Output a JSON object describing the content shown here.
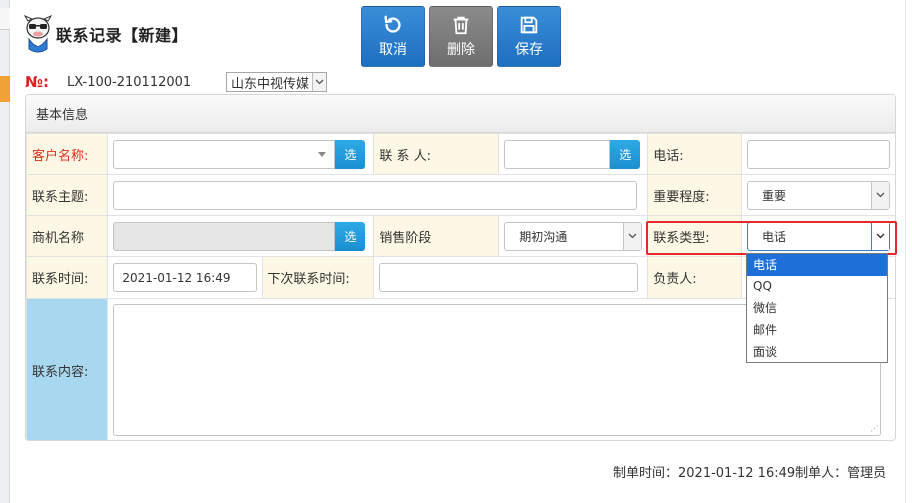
{
  "page": {
    "title": "联系记录【新建】",
    "number_label": "№:",
    "number_value": "LX-100-210112001",
    "company": "山东中视传媒"
  },
  "toolbar": {
    "cancel_label": "取消",
    "delete_label": "删除",
    "save_label": "保存"
  },
  "panel": {
    "title": "基本信息"
  },
  "form": {
    "customer_label": "客户名称:",
    "customer_value": "",
    "pick_label": "选",
    "contact_label": "联 系 人:",
    "contact_value": "",
    "phone_label": "电话:",
    "phone_value": "",
    "subject_label": "联系主题:",
    "subject_value": "",
    "importance_label": "重要程度:",
    "importance_value": "重要",
    "opportunity_label": "商机名称",
    "opportunity_value": "",
    "stage_label": "销售阶段",
    "stage_value": "期初沟通",
    "contact_type_label": "联系类型:",
    "contact_type_value": "电话",
    "contact_time_label": "联系时间:",
    "contact_time_value": "2021-01-12 16:49",
    "next_time_label": "下次联系时间:",
    "next_time_value": "",
    "owner_label": "负责人:",
    "owner_value": "",
    "content_label": "联系内容:",
    "content_value": ""
  },
  "dropdown": {
    "options": [
      "电话",
      "QQ",
      "微信",
      "邮件",
      "面谈"
    ],
    "selected_index": 0
  },
  "footer": {
    "text": "制单时间：2021-01-12 16:49制单人：管理员"
  },
  "colors": {
    "primary_button": "#1e6fc0",
    "disabled_button": "#7a7a7a",
    "label_bg": "#fdf7e6",
    "content_label_bg": "#a8d8f0",
    "highlight_border": "#e8272a",
    "required_label": "#e0301e",
    "pick_button": "#1a8fd0",
    "dropdown_selected": "#1e70d8"
  }
}
